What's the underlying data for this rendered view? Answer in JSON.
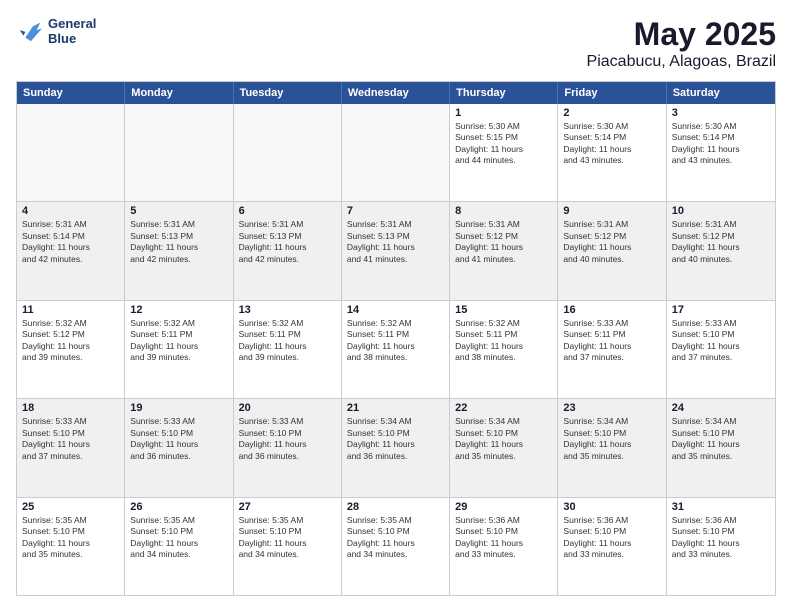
{
  "header": {
    "logo_line1": "General",
    "logo_line2": "Blue",
    "title": "May 2025",
    "subtitle": "Piacabucu, Alagoas, Brazil"
  },
  "days": [
    "Sunday",
    "Monday",
    "Tuesday",
    "Wednesday",
    "Thursday",
    "Friday",
    "Saturday"
  ],
  "weeks": [
    [
      {
        "day": "",
        "info": ""
      },
      {
        "day": "",
        "info": ""
      },
      {
        "day": "",
        "info": ""
      },
      {
        "day": "",
        "info": ""
      },
      {
        "day": "1",
        "info": "Sunrise: 5:30 AM\nSunset: 5:15 PM\nDaylight: 11 hours\nand 44 minutes."
      },
      {
        "day": "2",
        "info": "Sunrise: 5:30 AM\nSunset: 5:14 PM\nDaylight: 11 hours\nand 43 minutes."
      },
      {
        "day": "3",
        "info": "Sunrise: 5:30 AM\nSunset: 5:14 PM\nDaylight: 11 hours\nand 43 minutes."
      }
    ],
    [
      {
        "day": "4",
        "info": "Sunrise: 5:31 AM\nSunset: 5:14 PM\nDaylight: 11 hours\nand 42 minutes."
      },
      {
        "day": "5",
        "info": "Sunrise: 5:31 AM\nSunset: 5:13 PM\nDaylight: 11 hours\nand 42 minutes."
      },
      {
        "day": "6",
        "info": "Sunrise: 5:31 AM\nSunset: 5:13 PM\nDaylight: 11 hours\nand 42 minutes."
      },
      {
        "day": "7",
        "info": "Sunrise: 5:31 AM\nSunset: 5:13 PM\nDaylight: 11 hours\nand 41 minutes."
      },
      {
        "day": "8",
        "info": "Sunrise: 5:31 AM\nSunset: 5:12 PM\nDaylight: 11 hours\nand 41 minutes."
      },
      {
        "day": "9",
        "info": "Sunrise: 5:31 AM\nSunset: 5:12 PM\nDaylight: 11 hours\nand 40 minutes."
      },
      {
        "day": "10",
        "info": "Sunrise: 5:31 AM\nSunset: 5:12 PM\nDaylight: 11 hours\nand 40 minutes."
      }
    ],
    [
      {
        "day": "11",
        "info": "Sunrise: 5:32 AM\nSunset: 5:12 PM\nDaylight: 11 hours\nand 39 minutes."
      },
      {
        "day": "12",
        "info": "Sunrise: 5:32 AM\nSunset: 5:11 PM\nDaylight: 11 hours\nand 39 minutes."
      },
      {
        "day": "13",
        "info": "Sunrise: 5:32 AM\nSunset: 5:11 PM\nDaylight: 11 hours\nand 39 minutes."
      },
      {
        "day": "14",
        "info": "Sunrise: 5:32 AM\nSunset: 5:11 PM\nDaylight: 11 hours\nand 38 minutes."
      },
      {
        "day": "15",
        "info": "Sunrise: 5:32 AM\nSunset: 5:11 PM\nDaylight: 11 hours\nand 38 minutes."
      },
      {
        "day": "16",
        "info": "Sunrise: 5:33 AM\nSunset: 5:11 PM\nDaylight: 11 hours\nand 37 minutes."
      },
      {
        "day": "17",
        "info": "Sunrise: 5:33 AM\nSunset: 5:10 PM\nDaylight: 11 hours\nand 37 minutes."
      }
    ],
    [
      {
        "day": "18",
        "info": "Sunrise: 5:33 AM\nSunset: 5:10 PM\nDaylight: 11 hours\nand 37 minutes."
      },
      {
        "day": "19",
        "info": "Sunrise: 5:33 AM\nSunset: 5:10 PM\nDaylight: 11 hours\nand 36 minutes."
      },
      {
        "day": "20",
        "info": "Sunrise: 5:33 AM\nSunset: 5:10 PM\nDaylight: 11 hours\nand 36 minutes."
      },
      {
        "day": "21",
        "info": "Sunrise: 5:34 AM\nSunset: 5:10 PM\nDaylight: 11 hours\nand 36 minutes."
      },
      {
        "day": "22",
        "info": "Sunrise: 5:34 AM\nSunset: 5:10 PM\nDaylight: 11 hours\nand 35 minutes."
      },
      {
        "day": "23",
        "info": "Sunrise: 5:34 AM\nSunset: 5:10 PM\nDaylight: 11 hours\nand 35 minutes."
      },
      {
        "day": "24",
        "info": "Sunrise: 5:34 AM\nSunset: 5:10 PM\nDaylight: 11 hours\nand 35 minutes."
      }
    ],
    [
      {
        "day": "25",
        "info": "Sunrise: 5:35 AM\nSunset: 5:10 PM\nDaylight: 11 hours\nand 35 minutes."
      },
      {
        "day": "26",
        "info": "Sunrise: 5:35 AM\nSunset: 5:10 PM\nDaylight: 11 hours\nand 34 minutes."
      },
      {
        "day": "27",
        "info": "Sunrise: 5:35 AM\nSunset: 5:10 PM\nDaylight: 11 hours\nand 34 minutes."
      },
      {
        "day": "28",
        "info": "Sunrise: 5:35 AM\nSunset: 5:10 PM\nDaylight: 11 hours\nand 34 minutes."
      },
      {
        "day": "29",
        "info": "Sunrise: 5:36 AM\nSunset: 5:10 PM\nDaylight: 11 hours\nand 33 minutes."
      },
      {
        "day": "30",
        "info": "Sunrise: 5:36 AM\nSunset: 5:10 PM\nDaylight: 11 hours\nand 33 minutes."
      },
      {
        "day": "31",
        "info": "Sunrise: 5:36 AM\nSunset: 5:10 PM\nDaylight: 11 hours\nand 33 minutes."
      }
    ]
  ]
}
